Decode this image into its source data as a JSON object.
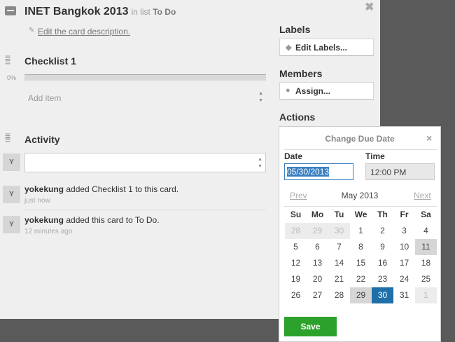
{
  "card": {
    "title": "INET Bangkok 2013",
    "in_list_prefix": "in list",
    "list_name": "To Do",
    "edit_description": "Edit the card description.",
    "close": "✖"
  },
  "checklist": {
    "title": "Checklist 1",
    "progress_label": "0%",
    "progress": 0,
    "add_item_placeholder": "Add item"
  },
  "activity": {
    "title": "Activity",
    "avatar": "Y",
    "items": [
      {
        "avatar": "Y",
        "user": "yokekung",
        "text": "added Checklist 1 to this card.",
        "time": "just now"
      },
      {
        "avatar": "Y",
        "user": "yokekung",
        "text": "added this card to To Do.",
        "time": "12 minutes ago"
      }
    ]
  },
  "sidebar": {
    "labels_heading": "Labels",
    "edit_labels": "Edit Labels...",
    "members_heading": "Members",
    "assign": "Assign...",
    "actions_heading": "Actions"
  },
  "due_popup": {
    "title": "Change Due Date",
    "close": "×",
    "date_label": "Date",
    "date_value": "05/30/2013",
    "time_label": "Time",
    "time_value": "12:00 PM",
    "prev": "Prev",
    "next": "Next",
    "month": "May 2013",
    "save": "Save",
    "weekdays": [
      "Su",
      "Mo",
      "Tu",
      "We",
      "Th",
      "Fr",
      "Sa"
    ],
    "weeks": [
      [
        "28",
        "29",
        "30",
        "1",
        "2",
        "3",
        "4"
      ],
      [
        "5",
        "6",
        "7",
        "8",
        "9",
        "10",
        "11"
      ],
      [
        "12",
        "13",
        "14",
        "15",
        "16",
        "17",
        "18"
      ],
      [
        "19",
        "20",
        "21",
        "22",
        "23",
        "24",
        "25"
      ],
      [
        "26",
        "27",
        "28",
        "29",
        "30",
        "31",
        "1"
      ]
    ],
    "selected": "30",
    "today": "11",
    "hover": "29"
  },
  "colors": {
    "accent": "#1f6fa8",
    "save": "#2ca22c"
  }
}
